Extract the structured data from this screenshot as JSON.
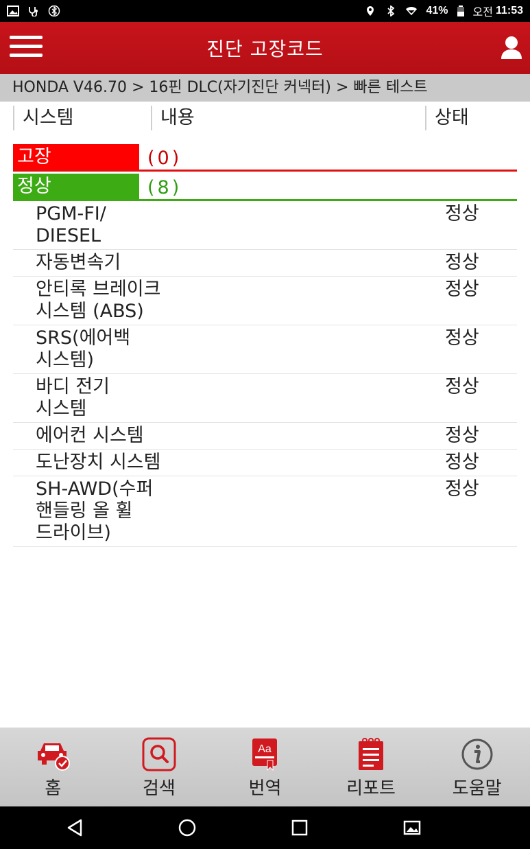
{
  "status_bar": {
    "battery": "41%",
    "time_period": "오전",
    "time": "11:53",
    "icons": [
      "image-icon",
      "stethoscope-icon",
      "bluetooth-icon",
      "location-icon",
      "bluetooth-icon",
      "wifi-icon",
      "battery-icon"
    ]
  },
  "header": {
    "title": "진단 고장코드",
    "menu_icon": "hamburger-menu-icon",
    "user_icon": "user-icon"
  },
  "breadcrumb": "HONDA V46.70 > 16핀 DLC(자기진단 커넥터) > 빠른 테스트",
  "columns": {
    "system": "시스템",
    "content": "내용",
    "status": "상태"
  },
  "groups": {
    "fault": {
      "label": "고장",
      "count": "(0)",
      "color": "#ff0000"
    },
    "normal": {
      "label": "정상",
      "count": "(8)",
      "color": "#3cab14"
    }
  },
  "rows": [
    {
      "system": "PGM-FI/ DIESEL",
      "status": "정상"
    },
    {
      "system": "자동변속기",
      "status": "정상"
    },
    {
      "system": "안티록 브레이크 시스템 (ABS)",
      "status": "정상"
    },
    {
      "system": "SRS(에어백 시스템)",
      "status": "정상"
    },
    {
      "system": "바디 전기 시스템",
      "status": "정상"
    },
    {
      "system": "에어컨 시스템",
      "status": "정상"
    },
    {
      "system": "도난장치 시스템",
      "status": "정상"
    },
    {
      "system": "SH-AWD(수퍼 핸들링 올 휠 드라이브)",
      "status": "정상"
    }
  ],
  "bottom_nav": [
    {
      "label": "홈",
      "icon": "car-check-icon"
    },
    {
      "label": "검색",
      "icon": "search-icon"
    },
    {
      "label": "번역",
      "icon": "translate-book-icon"
    },
    {
      "label": "리포트",
      "icon": "report-notepad-icon"
    },
    {
      "label": "도움말",
      "icon": "info-icon"
    }
  ],
  "accent_color": "#c8141b"
}
